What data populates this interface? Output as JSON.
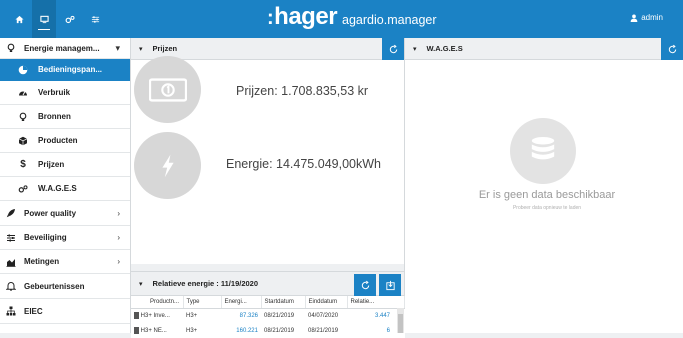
{
  "topbar": {
    "nav_icons": [
      "home-icon",
      "monitor-icon",
      "cogs-icon",
      "sliders-icon"
    ],
    "brand_logo": "hager",
    "brand_product": "agardio.manager",
    "user_name": "admin"
  },
  "sidebar": {
    "items": [
      {
        "label": "Energie managem...",
        "icon": "bulb-icon",
        "chevron": "▾",
        "type": "top"
      },
      {
        "label": "Bedieningspan...",
        "icon": "dashboard-icon",
        "type": "sub",
        "selected": true
      },
      {
        "label": "Verbruik",
        "icon": "gauge-icon",
        "type": "sub"
      },
      {
        "label": "Bronnen",
        "icon": "bulb-icon",
        "type": "sub"
      },
      {
        "label": "Producten",
        "icon": "cube-icon",
        "type": "sub"
      },
      {
        "label": "Prijzen",
        "icon": "dollar-icon",
        "type": "sub"
      },
      {
        "label": "W.A.G.E.S",
        "icon": "cogs-icon",
        "type": "sub"
      },
      {
        "label": "Power quality",
        "icon": "rocket-icon",
        "chevron": "›",
        "type": "top"
      },
      {
        "label": "Beveiliging",
        "icon": "sliders-icon",
        "chevron": "›",
        "type": "top"
      },
      {
        "label": "Metingen",
        "icon": "area-chart-icon",
        "chevron": "›",
        "type": "top"
      },
      {
        "label": "Gebeurtenissen",
        "icon": "bell-icon",
        "type": "top"
      },
      {
        "label": "EIEC",
        "icon": "sitemap-icon",
        "type": "top"
      }
    ]
  },
  "prijzen_panel": {
    "title": "Prijzen",
    "chevron": "▾",
    "price_text": "Prijzen: 1.708.835,53 kr",
    "energy_text": "Energie: 14.475.049,00kWh"
  },
  "wages_panel": {
    "title": "W.A.G.E.S",
    "chevron": "▾",
    "nodata_title": "Er is geen data beschikbaar",
    "nodata_sub": "Probeer data opnieuw te laden"
  },
  "energy_panel": {
    "title": "Relatieve energie : 11/19/2020",
    "chevron": "▾",
    "columns": [
      "Productn...",
      "Type",
      "Energi...",
      "Startdatum",
      "Einddatum",
      "Relatie..."
    ],
    "rows": [
      {
        "product": "H3+ Inve...",
        "type": "H3+",
        "energy": "87.326",
        "start": "08/21/2019",
        "end": "04/07/2020",
        "relative": "3.447"
      },
      {
        "product": "H3+ NE...",
        "type": "H3+",
        "energy": "160.221",
        "start": "08/21/2019",
        "end": "08/21/2019",
        "relative": "6"
      }
    ]
  },
  "colors": {
    "accent": "#1b82c5",
    "background": "#eef0f2",
    "placeholder_gray": "#d7d7d7"
  }
}
